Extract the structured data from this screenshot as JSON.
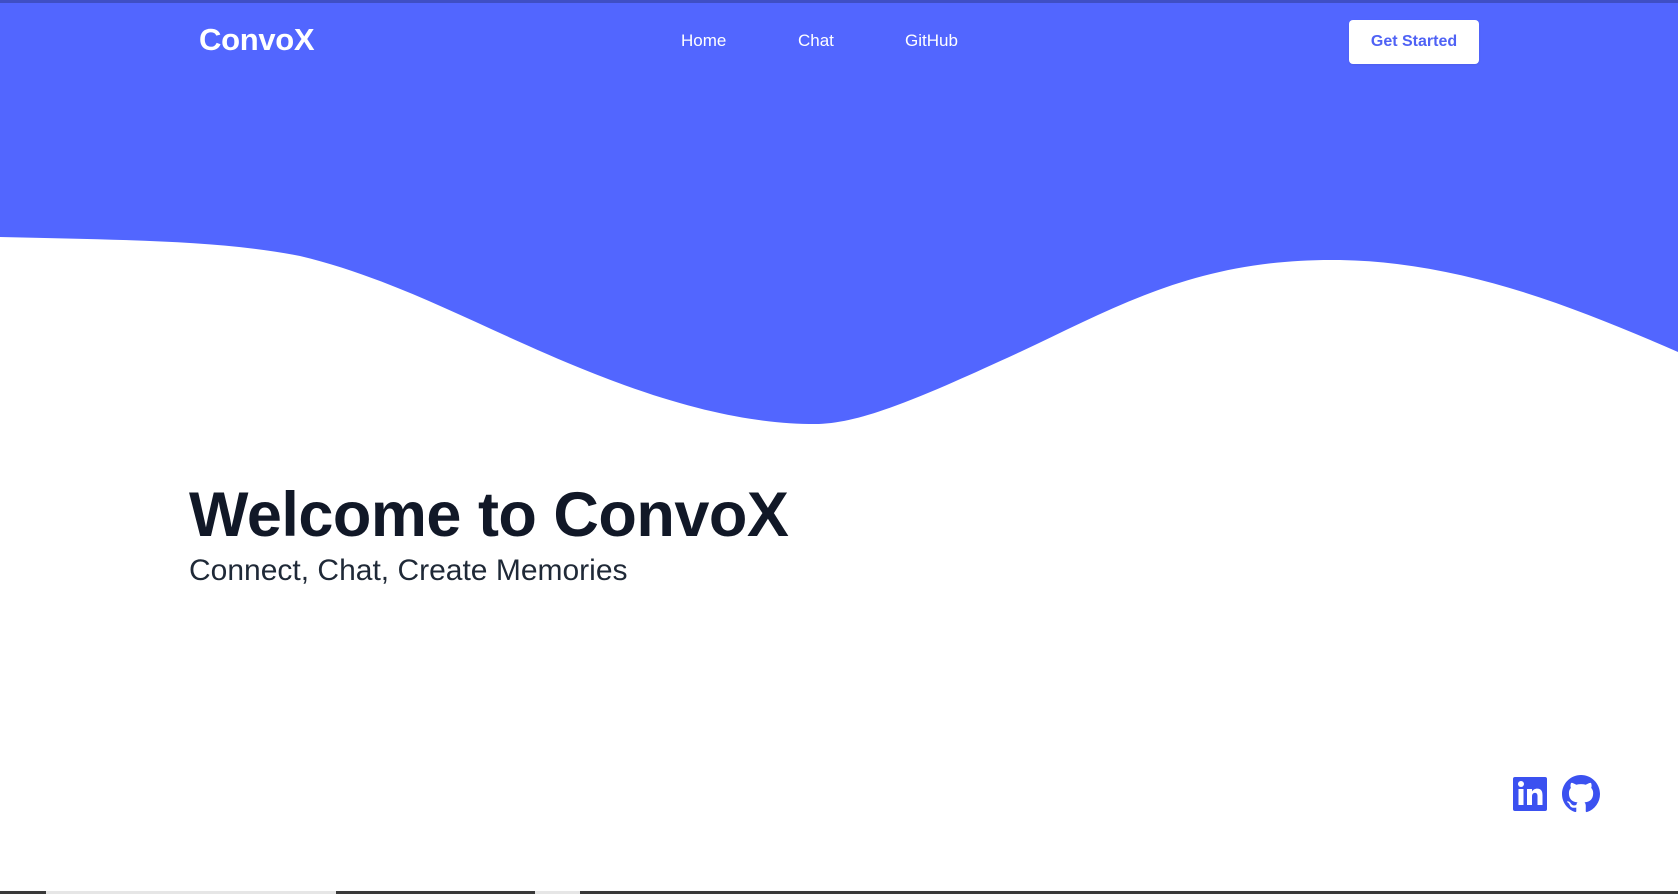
{
  "brand": {
    "name": "ConvoX",
    "accent_color": "#5266ff",
    "text_dark": "#111827"
  },
  "nav": {
    "links": [
      {
        "label": "Home"
      },
      {
        "label": "Chat"
      },
      {
        "label": "GitHub"
      }
    ],
    "cta_label": "Get Started"
  },
  "hero": {
    "title": "Welcome to ConvoX",
    "subtitle": "Connect, Chat, Create Memories"
  },
  "social": {
    "icons": [
      "linkedin-icon",
      "github-icon"
    ]
  }
}
